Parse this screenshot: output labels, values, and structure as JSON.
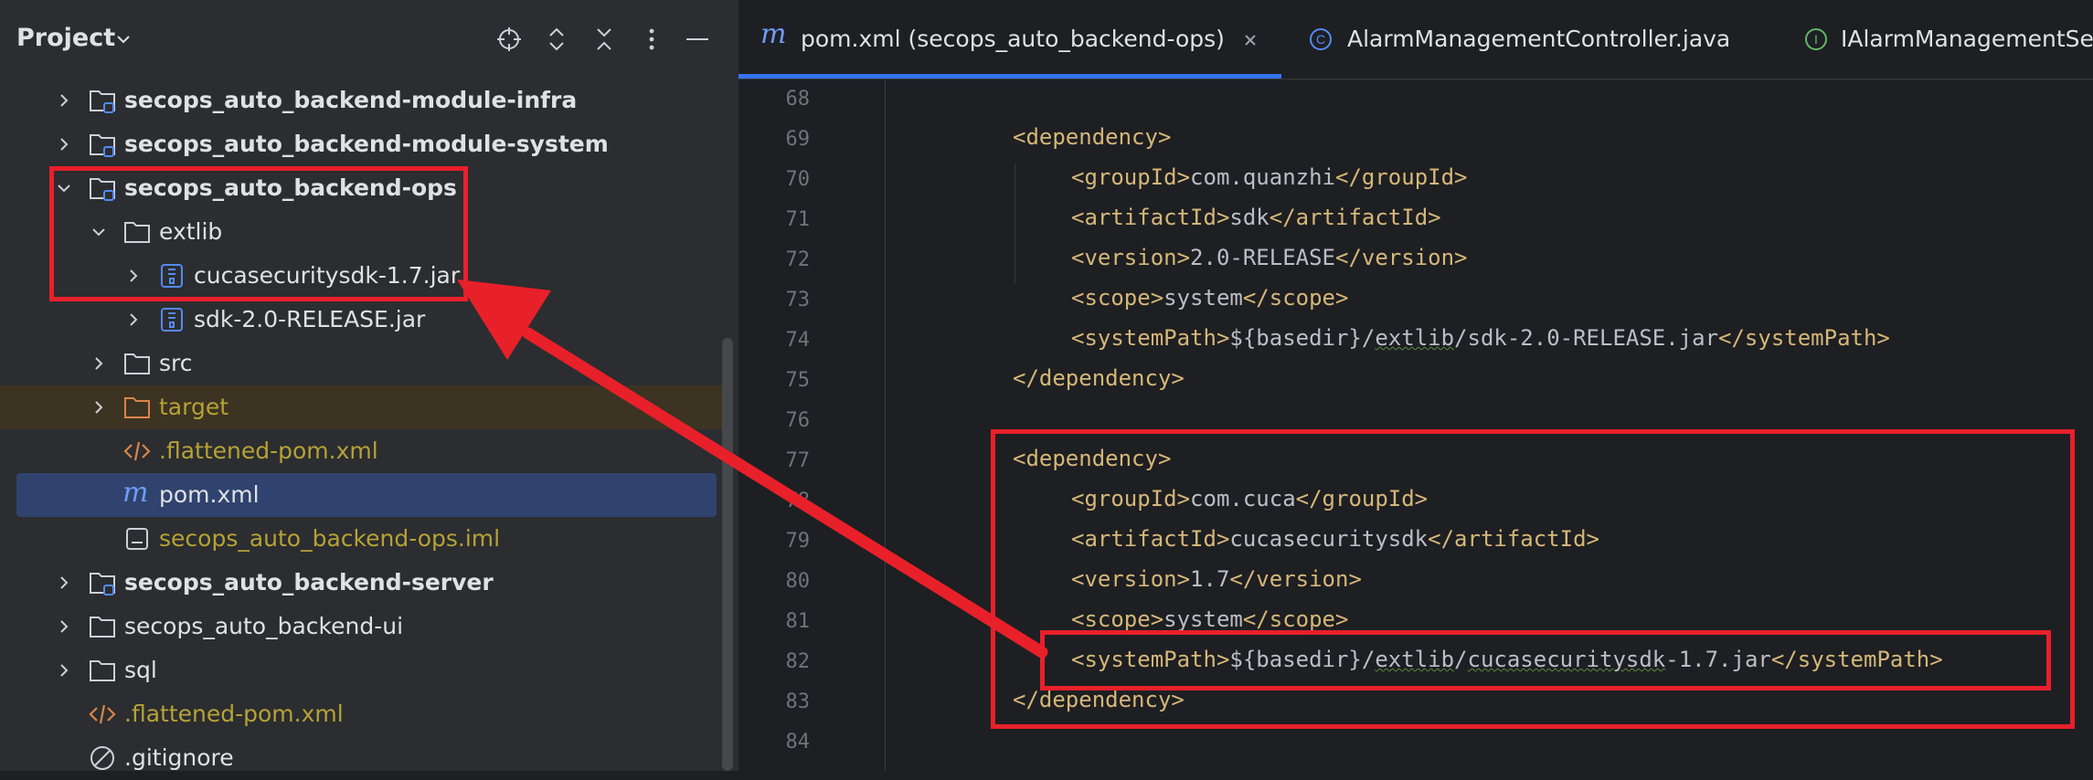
{
  "project_panel": {
    "title": "Project",
    "header_icons": [
      "locate-icon",
      "expand-all-icon",
      "collapse-all-icon",
      "more-options-icon",
      "hide-icon"
    ],
    "tree": [
      {
        "label": "secops_auto_backend-module-infra",
        "icon": "module-folder-icon",
        "expanded": false,
        "style": "bold"
      },
      {
        "label": "secops_auto_backend-module-system",
        "icon": "module-folder-icon",
        "expanded": false,
        "style": "bold"
      },
      {
        "label": "secops_auto_backend-ops",
        "icon": "module-folder-icon",
        "expanded": true,
        "style": "bold"
      },
      {
        "label": "extlib",
        "icon": "folder-icon",
        "expanded": true,
        "style": "normal"
      },
      {
        "label": "cucasecuritysdk-1.7.jar",
        "icon": "jar-icon",
        "expanded": false,
        "style": "normal"
      },
      {
        "label": "sdk-2.0-RELEASE.jar",
        "icon": "jar-icon",
        "expanded": false,
        "style": "normal"
      },
      {
        "label": "src",
        "icon": "folder-icon",
        "expanded": false,
        "style": "normal"
      },
      {
        "label": "target",
        "icon": "excluded-folder-icon",
        "expanded": false,
        "style": "olive"
      },
      {
        "label": ".flattened-pom.xml",
        "icon": "xml-file-icon",
        "style": "olive"
      },
      {
        "label": "pom.xml",
        "icon": "maven-icon",
        "style": "selected"
      },
      {
        "label": "secops_auto_backend-ops.iml",
        "icon": "iml-file-icon",
        "style": "olive"
      },
      {
        "label": "secops_auto_backend-server",
        "icon": "module-folder-icon",
        "expanded": false,
        "style": "bold"
      },
      {
        "label": "secops_auto_backend-ui",
        "icon": "folder-icon",
        "expanded": false,
        "style": "normal"
      },
      {
        "label": "sql",
        "icon": "folder-icon",
        "expanded": false,
        "style": "normal"
      },
      {
        "label": ".flattened-pom.xml",
        "icon": "xml-file-icon",
        "style": "olive"
      },
      {
        "label": ".gitignore",
        "icon": "ignore-file-icon",
        "style": "normal"
      }
    ]
  },
  "editor": {
    "tabs": [
      {
        "label": "pom.xml (secops_auto_backend-ops)",
        "icon": "maven-icon",
        "active": true
      },
      {
        "label": "AlarmManagementController.java",
        "icon": "class-icon",
        "active": false
      },
      {
        "label": "IAlarmManagementServ",
        "icon": "interface-icon",
        "active": false
      }
    ],
    "line_numbers": [
      "68",
      "69",
      "70",
      "71",
      "72",
      "73",
      "74",
      "75",
      "76",
      "77",
      "78",
      "79",
      "80",
      "81",
      "82",
      "83",
      "84"
    ],
    "code": {
      "l69_open": "<dependency>",
      "l70_open": "<groupId>",
      "l70_text": "com.quanzhi",
      "l70_close": "</groupId>",
      "l71_open": "<artifactId>",
      "l71_text": "sdk",
      "l71_close": "</artifactId>",
      "l72_open": "<version>",
      "l72_text": "2.0-RELEASE",
      "l72_close": "</version>",
      "l73_open": "<scope>",
      "l73_text": "system",
      "l73_close": "</scope>",
      "l74_open": "<systemPath>",
      "l74_text_a": "${basedir}/",
      "l74_text_b": "extlib",
      "l74_text_c": "/sdk-2.0-RELEASE.jar",
      "l74_close": "</systemPath>",
      "l75_close": "</dependency>",
      "l77_open": "<dependency>",
      "l78_open": "<groupId>",
      "l78_text": "com.cuca",
      "l78_close": "</groupId>",
      "l79_open": "<artifactId>",
      "l79_text": "cucasecuritysdk",
      "l79_close": "</artifactId>",
      "l80_open": "<version>",
      "l80_text": "1.7",
      "l80_close": "</version>",
      "l81_open": "<scope>",
      "l81_text": "system",
      "l81_close": "</scope>",
      "l82_open": "<systemPath>",
      "l82_text_a": "${basedir}/",
      "l82_text_b": "extlib",
      "l82_text_c": "/",
      "l82_text_d": "cucasecuritysdk",
      "l82_text_e": "-1.7.jar",
      "l82_close": "</systemPath>",
      "l83_close": "</dependency>"
    }
  },
  "colors": {
    "annotation_red": "#e8202a",
    "selection": "#2f436e",
    "accent": "#3574f0",
    "xml_tag": "#d5b778"
  }
}
